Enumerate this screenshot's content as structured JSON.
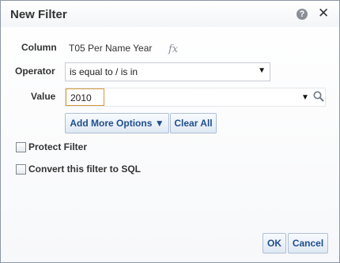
{
  "dialog": {
    "title": "New Filter",
    "help_icon_glyph": "?",
    "close_icon_glyph": "✕"
  },
  "fields": {
    "column_label": "Column",
    "column_value": "T05 Per Name Year",
    "fx_glyph": "fx",
    "operator_label": "Operator",
    "operator_value": "is equal to / is in",
    "value_label": "Value",
    "value_text": "2010"
  },
  "buttons": {
    "add_more_options": "Add More Options ▼",
    "clear_all": "Clear All",
    "ok": "OK",
    "cancel": "Cancel"
  },
  "checkboxes": {
    "protect_filter": "Protect Filter",
    "convert_to_sql": "Convert this filter to SQL"
  },
  "icons": {
    "help": "help-icon",
    "close": "close-icon",
    "fx": "formula-icon",
    "dropdown": "chevron-down-icon",
    "search": "search-icon"
  },
  "colors": {
    "button_text": "#1f4e8c",
    "input_focus_border": "#d39a3a"
  }
}
